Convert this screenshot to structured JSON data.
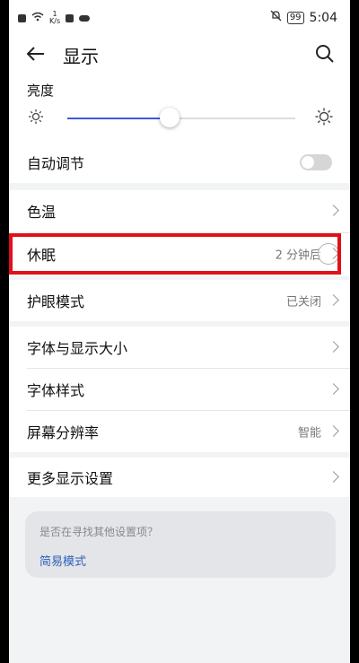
{
  "status_bar": {
    "speed": "1",
    "speed_unit": "K/s",
    "battery": "99",
    "time": "5:04"
  },
  "header": {
    "title": "显示"
  },
  "brightness": {
    "label": "亮度",
    "level": 0.45
  },
  "auto_adjust": {
    "label": "自动调节",
    "enabled": false
  },
  "rows": {
    "color_temp": {
      "label": "色温"
    },
    "sleep": {
      "label": "休眠",
      "value": "2 分钟后"
    },
    "eye_care": {
      "label": "护眼模式",
      "value": "已关闭"
    },
    "font_display_size": {
      "label": "字体与显示大小"
    },
    "font_style": {
      "label": "字体样式"
    },
    "resolution": {
      "label": "屏幕分辨率",
      "value": "智能"
    },
    "more_display": {
      "label": "更多显示设置"
    }
  },
  "suggestion": {
    "question": "是否在寻找其他设置项？",
    "link": "简易模式"
  },
  "colors": {
    "accent": "#3b5bdb",
    "highlight": "#e0101a",
    "link": "#2d5fb8"
  }
}
